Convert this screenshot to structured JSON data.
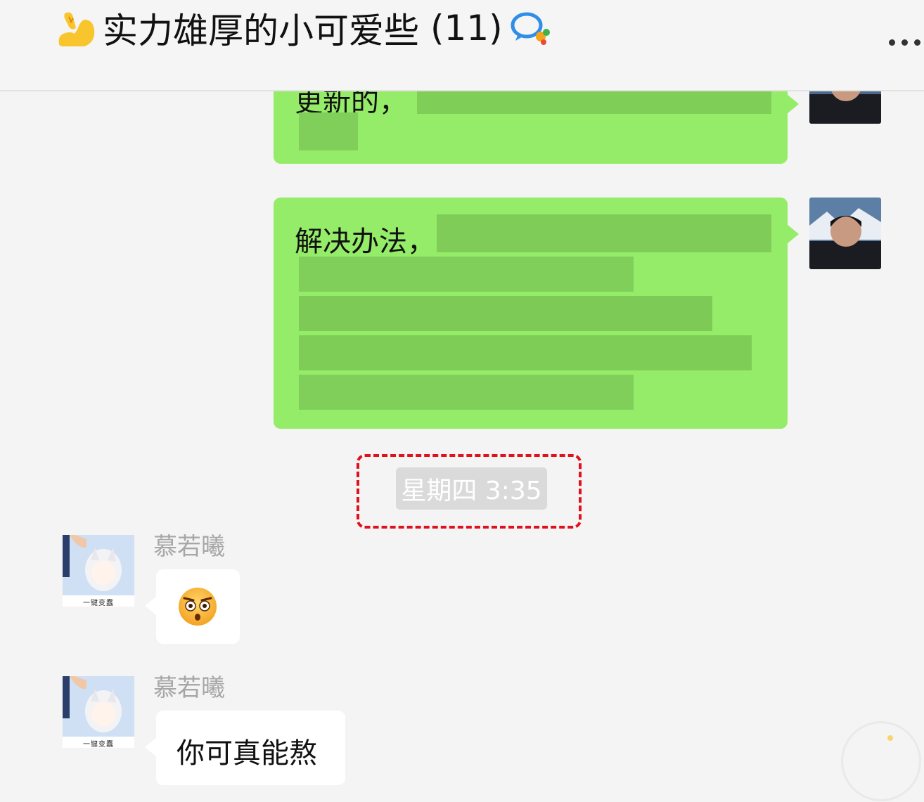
{
  "header": {
    "emoji_icon": "flexed-biceps-icon",
    "title": "实力雄厚的小可爱些",
    "member_count": "(11)",
    "group_icon": "chat-bubbles-icon",
    "more_icon": "more-dots-icon"
  },
  "messages": [
    {
      "side": "me",
      "text_visible": "更新的，",
      "blurred": true
    },
    {
      "side": "me",
      "text_visible": "解决办法，",
      "blurred": true
    },
    {
      "type": "time",
      "text": "星期四 3:35"
    },
    {
      "side": "other",
      "sender": "慕若曦",
      "content_type": "emoji",
      "emoji": "shocked-face-icon"
    },
    {
      "side": "other",
      "sender": "慕若曦",
      "text": "你可真能熬"
    }
  ],
  "avatar_caption": "一键变蠢",
  "colors": {
    "my_bubble": "#95ec69",
    "other_bubble": "#ffffff",
    "background": "#f4f4f4",
    "highlight": "#e0101c"
  }
}
